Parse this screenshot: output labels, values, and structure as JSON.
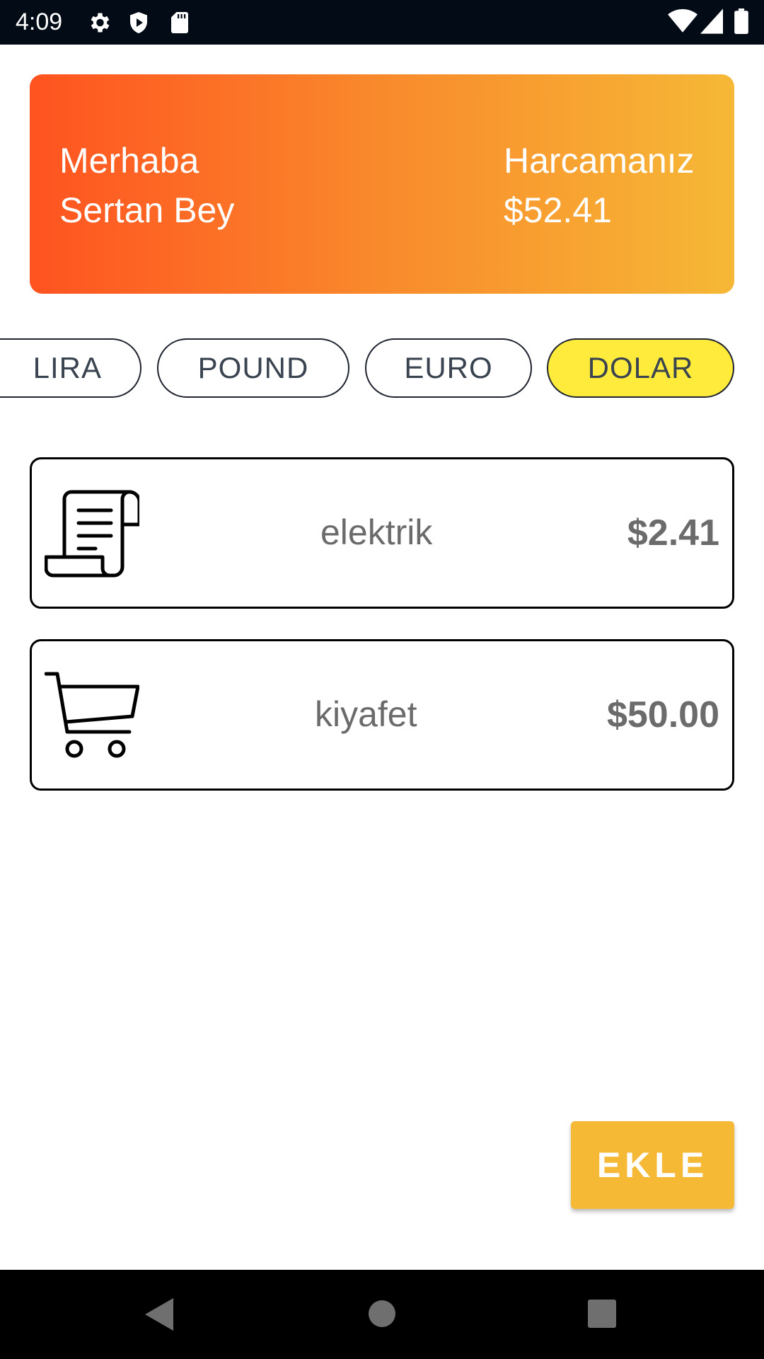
{
  "status_bar": {
    "time": "4:09",
    "left_icons": [
      "settings-icon",
      "shield-play-icon",
      "sd-card-icon"
    ],
    "right_icons": [
      "wifi-icon",
      "signal-icon",
      "battery-icon"
    ]
  },
  "header_card": {
    "greeting": "Merhaba",
    "name": "Sertan Bey",
    "spend_label": "Harcamanız",
    "spend_value": "$52.41",
    "gradient": [
      "#ff5320",
      "#f6b836"
    ]
  },
  "currency_chips": [
    {
      "label": "LIRA",
      "selected": false
    },
    {
      "label": "POUND",
      "selected": false
    },
    {
      "label": "EURO",
      "selected": false
    },
    {
      "label": "DOLAR",
      "selected": true
    }
  ],
  "expenses": [
    {
      "icon": "receipt-icon",
      "name": "elektrik",
      "amount": "$2.41"
    },
    {
      "icon": "shopping-cart-icon",
      "name": "kiyafet",
      "amount": "$50.00"
    }
  ],
  "add_button": {
    "label": "EKLE",
    "color": "#f5b935"
  },
  "nav_bar": {
    "buttons": [
      "back-icon",
      "home-icon",
      "recents-icon"
    ]
  }
}
